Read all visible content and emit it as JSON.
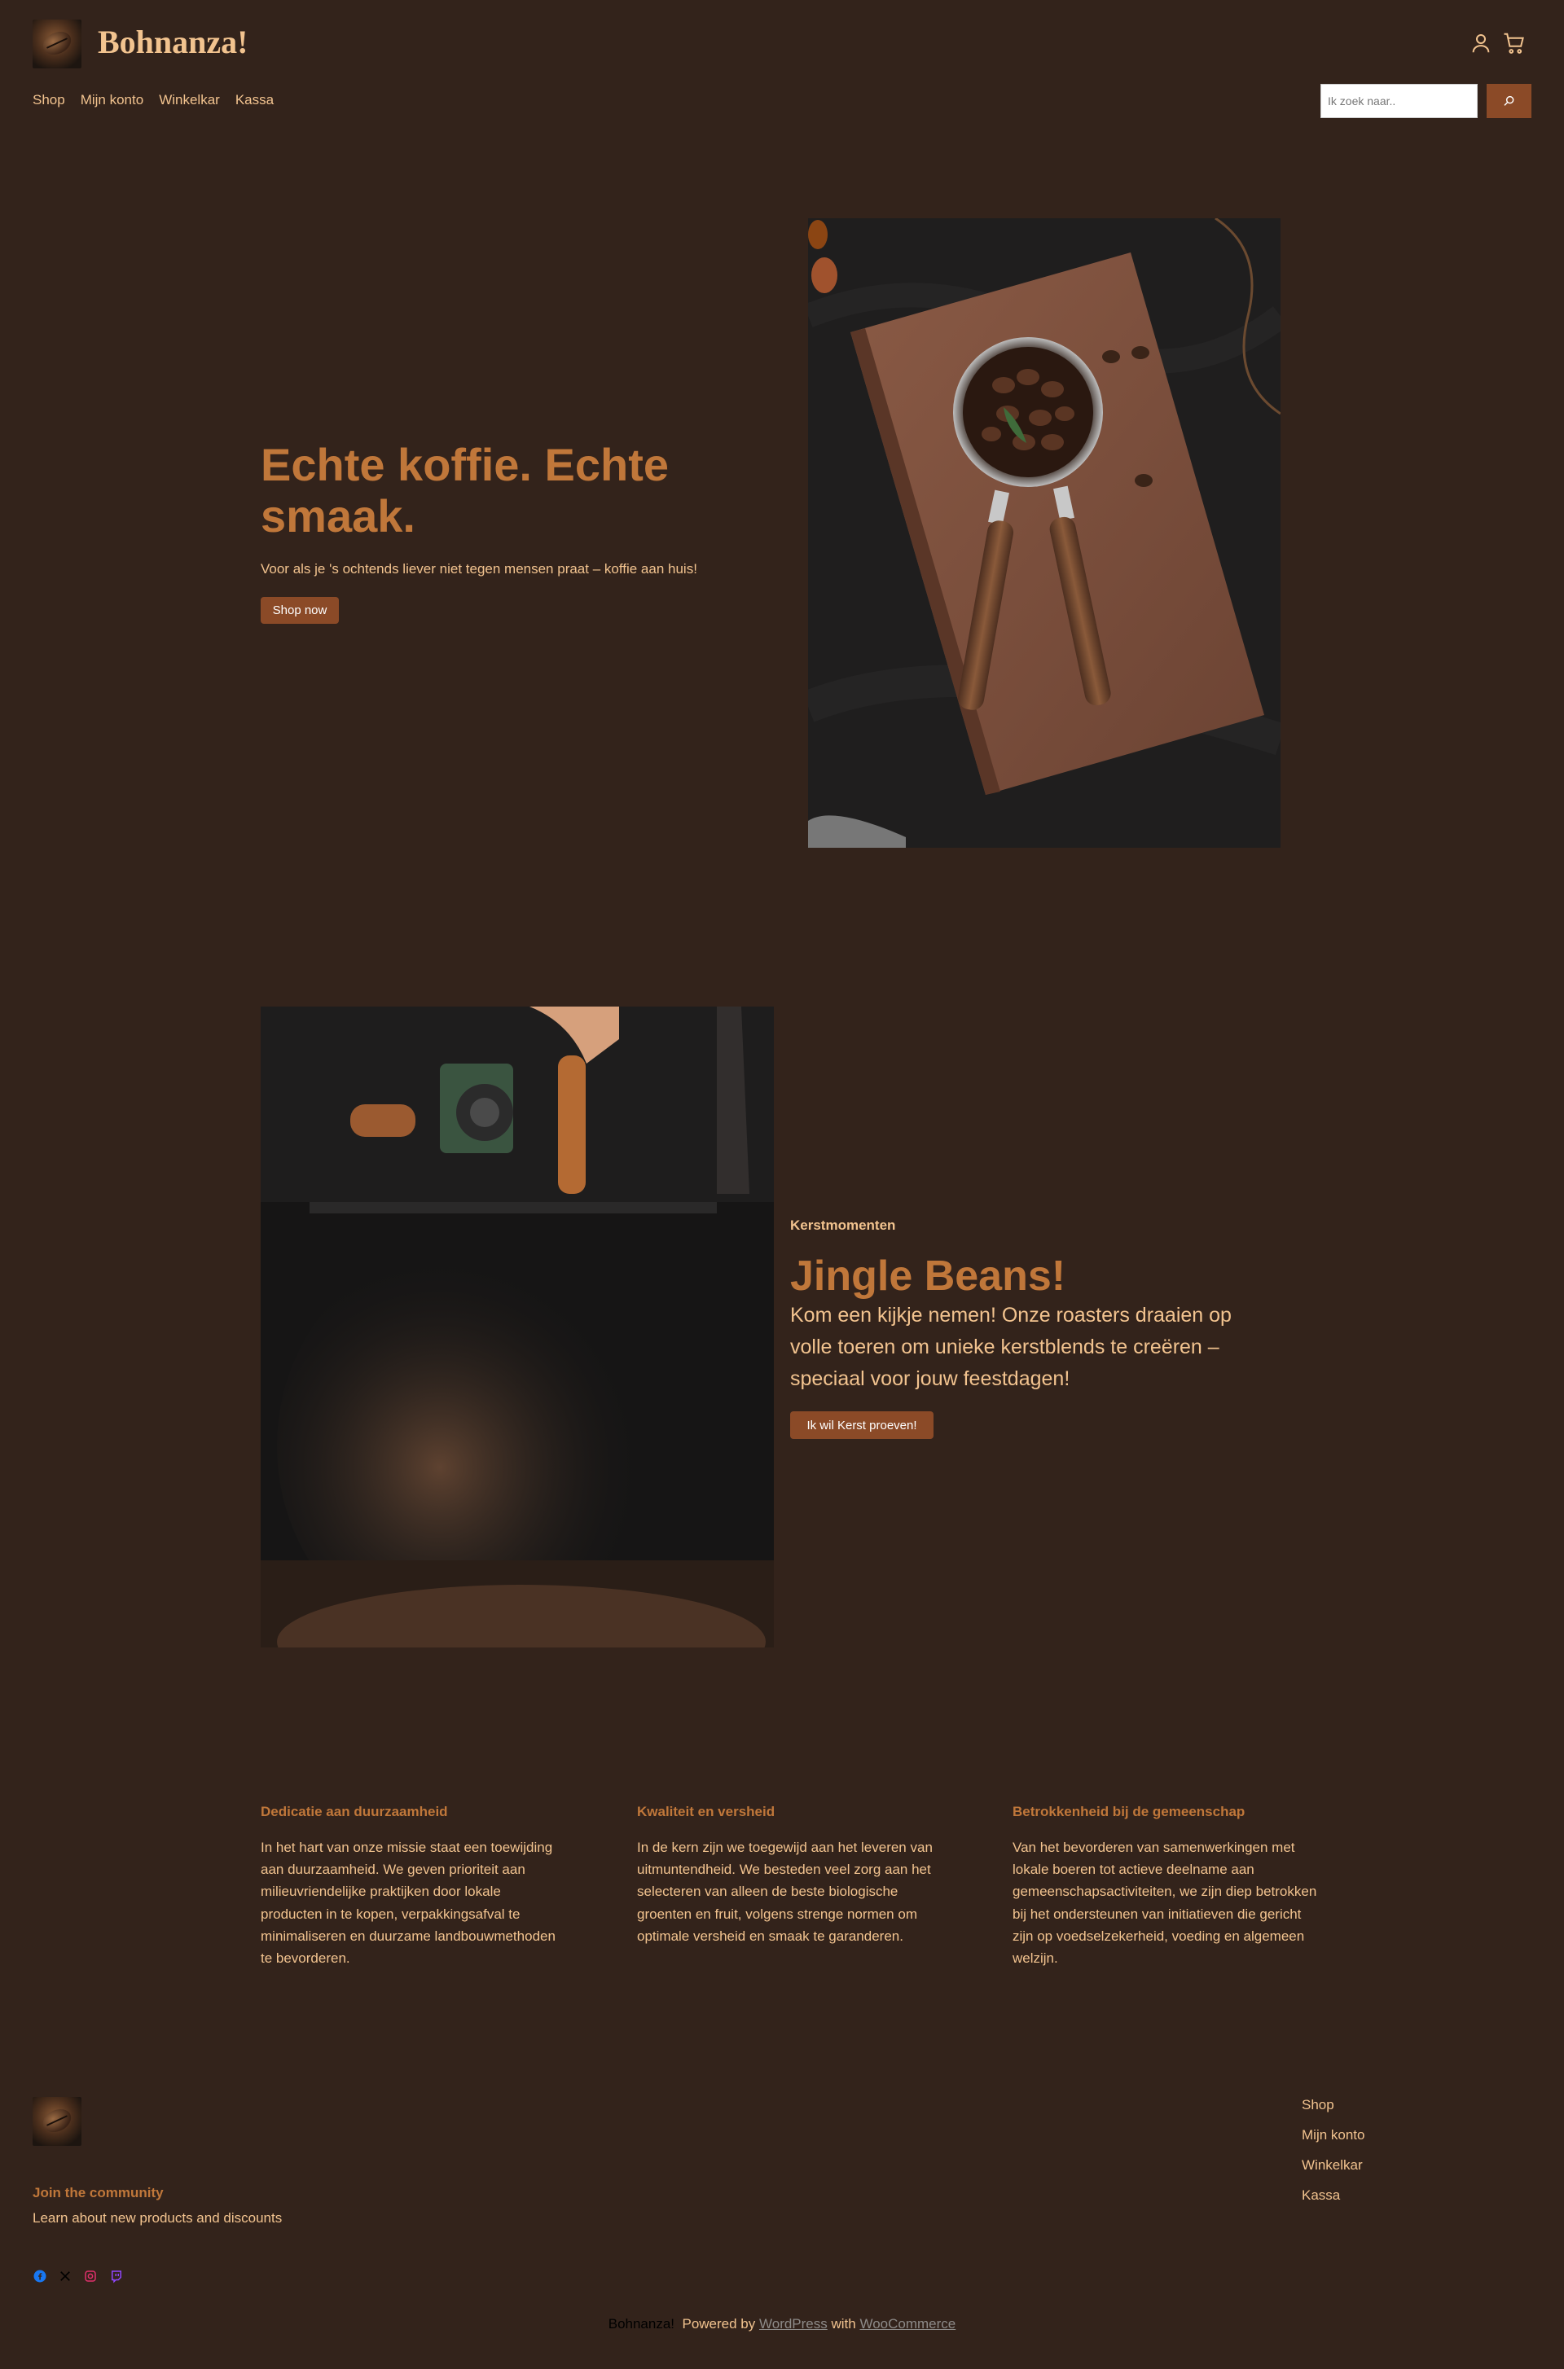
{
  "header": {
    "site_title": "Bohnanza!",
    "nav": [
      "Shop",
      "Mijn konto",
      "Winkelkar",
      "Kassa"
    ],
    "search_placeholder": "Ik zoek naar..",
    "icons": [
      "account-icon",
      "cart-icon",
      "search-icon"
    ]
  },
  "hero": {
    "title": "Echte koffie. Echte smaak.",
    "subtitle": "Voor als je 's ochtends liever niet tegen mensen praat – koffie aan huis!",
    "button": "Shop now"
  },
  "jingle": {
    "kicker": "Kerstmomenten",
    "title": "Jingle Beans!",
    "text": "Kom een kijkje nemen! Onze roasters draaien op volle toeren om unieke kerstblends te creëren – speciaal voor jouw feestdagen!",
    "button": "Ik wil Kerst proeven!"
  },
  "columns": [
    {
      "title": "Dedicatie aan duurzaamheid",
      "text": "In het hart van onze missie staat een toewijding aan duurzaamheid. We geven prioriteit aan milieuvriendelijke praktijken door lokale producten in te kopen, verpakkingsafval te minimaliseren en duurzame landbouwmethoden te bevorderen."
    },
    {
      "title": "Kwaliteit en versheid",
      "text": "In de kern zijn we toegewijd aan het leveren van uitmuntendheid. We besteden veel zorg aan het selecteren van alleen de beste biologische groenten en fruit, volgens strenge normen om optimale versheid en smaak te garanderen."
    },
    {
      "title": "Betrokkenheid bij de gemeenschap",
      "text": "Van het bevorderen van samenwerkingen met lokale boeren tot actieve deelname aan gemeenschapsactiviteiten, we zijn diep betrokken bij het ondersteunen van initiatieven die gericht zijn op voedselzekerheid, voeding en algemeen welzijn."
    }
  ],
  "footer": {
    "join_title": "Join the community",
    "join_text": "Learn about new products and discounts",
    "social": [
      "facebook-icon",
      "x-icon",
      "instagram-icon",
      "twitch-icon"
    ],
    "nav": [
      "Shop",
      "Mijn konto",
      "Winkelkar",
      "Kassa"
    ],
    "credit_brand": "Bohnanza!",
    "credit_powered": "Powered by",
    "credit_wordpress": "WordPress",
    "credit_with": "with",
    "credit_woocommerce": "WooCommerce"
  },
  "colors": {
    "background": "#33231b",
    "accent": "#c0773a",
    "text": "#f2c38f",
    "button": "#8b4a27"
  }
}
